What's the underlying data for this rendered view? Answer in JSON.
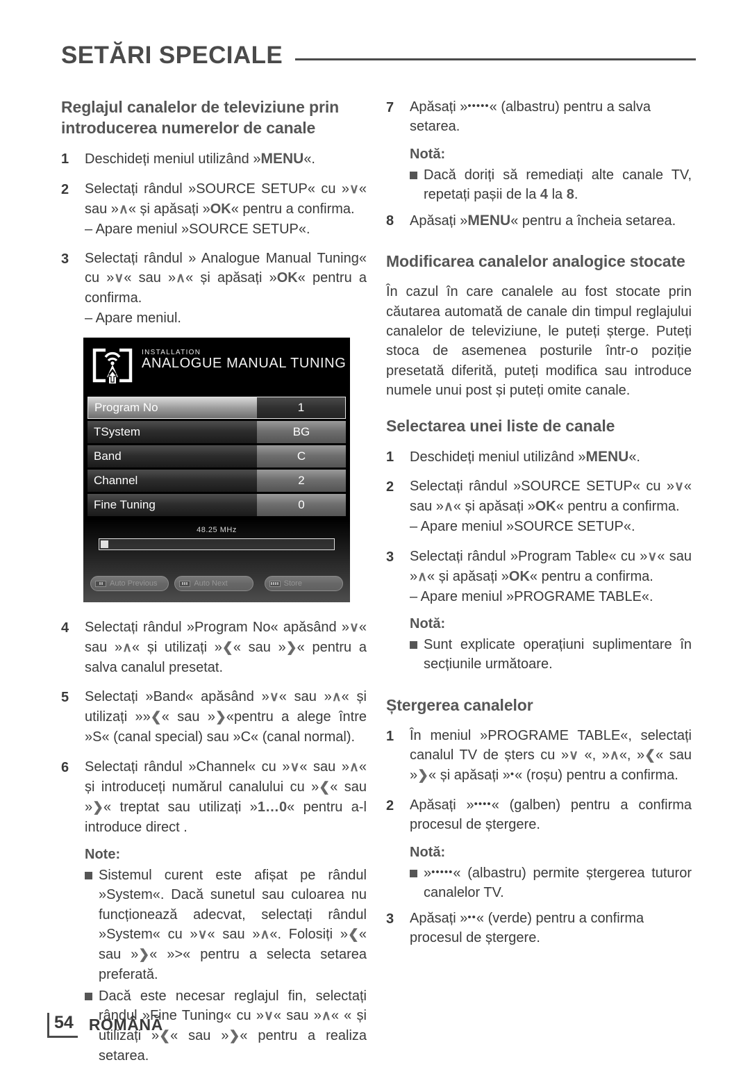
{
  "header": {
    "title": "SETĂRI SPECIALE"
  },
  "left": {
    "heading": "Reglajul canalelor de televiziune prin introducerea numerelor de canale",
    "step1": {
      "num": "1",
      "text_a": "Deschideți meniul utilizând »",
      "key": "MENU",
      "text_b": "«."
    },
    "step2": {
      "num": "2",
      "line1_a": "Selectați rândul »SOURCE SETUP« cu »",
      "arrow_down": "∨",
      "line1_b": "«",
      "line2_a": "sau »",
      "arrow_up": "∧",
      "line2_b": "« și apăsați »",
      "ok": "OK",
      "line2_c": "« pentru a confirma.",
      "result": "– Apare meniul »SOURCE SETUP«."
    },
    "step3": {
      "num": "3",
      "line1": "Selectați rândul » Analogue Manual Tuning«",
      "line2_a": "cu »",
      "arrow_down": "∨",
      "line2_b": "« sau »",
      "arrow_up": "∧",
      "line2_c": "« și apăsați »",
      "ok": "OK",
      "line2_d": "« pentru a confirma.",
      "result": "– Apare meniul."
    },
    "step4": {
      "num": "4",
      "a": "Selectați rândul »Program No« apăsând »",
      "arrow_down": "∨",
      "b": "« sau »",
      "arrow_up": "∧",
      "c": "« și utilizați »",
      "arrow_left": "❮",
      "d": "« sau »",
      "arrow_right": "❯",
      "e": "« pentru a salva canalul presetat."
    },
    "step5": {
      "num": "5",
      "a": "Selectați »Band« apăsând »",
      "arrow_down": "∨",
      "b": "« sau »",
      "arrow_up": "∧",
      "c": "« și utilizați »»",
      "arrow_left": "❮",
      "d": "« sau »",
      "arrow_right": "❯",
      "e": "«pentru a alege între »S« (canal special) sau »C« (canal normal)."
    },
    "step6": {
      "num": "6",
      "a": "Selectați rândul »Channel« cu »",
      "arrow_down": "∨",
      "b": "« sau »",
      "arrow_up": "∧",
      "c": "« și introduceți numărul canalului cu »",
      "arrow_left": "❮",
      "d": "« sau »",
      "arrow_right": "❯",
      "e": "« treptat sau utilizați »",
      "keys": "1…0",
      "f": "« pentru a-l introduce direct ."
    },
    "note_heading": "Note:",
    "note1": {
      "a": "Sistemul curent este afișat pe rândul »System«. Dacă sunetul sau culoarea nu funcționează adecvat, selectați rândul »System« cu »",
      "arrow_down": "∨",
      "b": "« sau »",
      "arrow_up": "∧",
      "c": "«. Folosiți »",
      "arrow_left": "❮",
      "d": "« sau »",
      "arrow_right": "❯",
      "e": "« »>« pentru a selecta setarea preferată."
    },
    "note2": {
      "a": "Dacă este necesar reglajul fin, selectați rândul »Fine Tuning« cu »",
      "arrow_down": "∨",
      "b": "« sau »",
      "arrow_up": "∧",
      "c": "« « și utilizați »",
      "arrow_left": "❮",
      "d": "« sau »",
      "arrow_right": "❯",
      "e": "« pentru a realiza setarea."
    }
  },
  "tv_menu": {
    "icon": "installation-antenna-icon",
    "breadcrumb": "INSTALLATION",
    "title": "ANALOGUE MANUAL TUNING",
    "rows": [
      {
        "label": "Program No",
        "value": "1",
        "selected": true
      },
      {
        "label": "TSystem",
        "value": "BG",
        "selected": false
      },
      {
        "label": "Band",
        "value": "C",
        "selected": false
      },
      {
        "label": "Channel",
        "value": "2",
        "selected": false
      },
      {
        "label": "Fine Tuning",
        "value": "0",
        "selected": false
      }
    ],
    "frequency": "48.25 MHz",
    "buttons": [
      {
        "label": "Auto Previous",
        "cue_dots": 2
      },
      {
        "label": "Auto Next",
        "cue_dots": 3
      },
      {
        "label": "Store",
        "cue_dots": 4
      }
    ]
  },
  "right": {
    "step7": {
      "num": "7",
      "a": "Apăsați »",
      "dots": "•••••",
      "b": "« (albastru) pentru a salva setarea."
    },
    "note_heading_1": "Notă:",
    "note_a": {
      "a": "Dacă doriți să remediați alte canale TV, repetați pașii de la ",
      "k1": "4",
      "b": " la ",
      "k2": "8",
      "c": "."
    },
    "step8": {
      "num": "8",
      "a": "Apăsați »",
      "key": "MENU",
      "b": "« pentru a încheia setarea."
    },
    "heading2": "Modificarea canalelor analogice stocate",
    "paragraph": "În cazul în care canalele au fost stocate prin căutarea automată de canale din timpul reglajului canalelor de televiziune, le puteți șterge. Puteți stoca de asemenea posturile într-o poziție presetată diferită, puteți modifica sau introduce numele unui post și puteți omite canale.",
    "heading3": "Selectarea unei liste de canale",
    "s1": {
      "num": "1",
      "a": "Deschideți meniul utilizând »",
      "key": "MENU",
      "b": "«."
    },
    "s2": {
      "num": "2",
      "a": "Selectați rândul »SOURCE SETUP« cu »",
      "arrow_down": "∨",
      "b": "«",
      "c": "sau »",
      "arrow_up": "∧",
      "d": "« și apăsați »",
      "ok": "OK",
      "e": "« pentru a confirma.",
      "result": "– Apare meniul »SOURCE SETUP«."
    },
    "s3": {
      "num": "3",
      "a": "Selectați rândul »Program Table« cu »",
      "arrow_down": "∨",
      "b": "«",
      "c": "sau »",
      "arrow_up": "∧",
      "d": "« și apăsați »",
      "ok": "OK",
      "e": "« pentru a confirma.",
      "result": "– Apare meniul »PROGRAME TABLE«."
    },
    "note_heading_2": "Notă:",
    "note_b": "Sunt explicate operațiuni suplimentare în secțiunile următoare.",
    "heading4": "Ștergerea canalelor",
    "d1": {
      "num": "1",
      "a": "În meniul »PROGRAME TABLE«, selectați canalul TV de șters cu »",
      "arrow_down": "∨",
      "b": " «, »",
      "arrow_up": "∧",
      "c": "«, »",
      "arrow_left": "❮",
      "d": "« sau »",
      "arrow_right": "❯",
      "e": "« și apăsați »",
      "dots": "•",
      "f": "« (roșu) pentru a confirma."
    },
    "d2": {
      "num": "2",
      "a": "Apăsați »",
      "dots": "••••",
      "b": "« (galben) pentru a confirma procesul de ștergere."
    },
    "note_heading_3": "Notă:",
    "note_c": {
      "a": "»",
      "dots": "•••••",
      "b": "« (albastru) permite ștergerea tuturor canalelor TV."
    },
    "d3": {
      "num": "3",
      "a": "Apăsați »",
      "dots": "••",
      "b": "« (verde) pentru a confirma procesul de ștergere."
    }
  },
  "footer": {
    "page_number": "54",
    "language": "ROMÂNĂ"
  }
}
